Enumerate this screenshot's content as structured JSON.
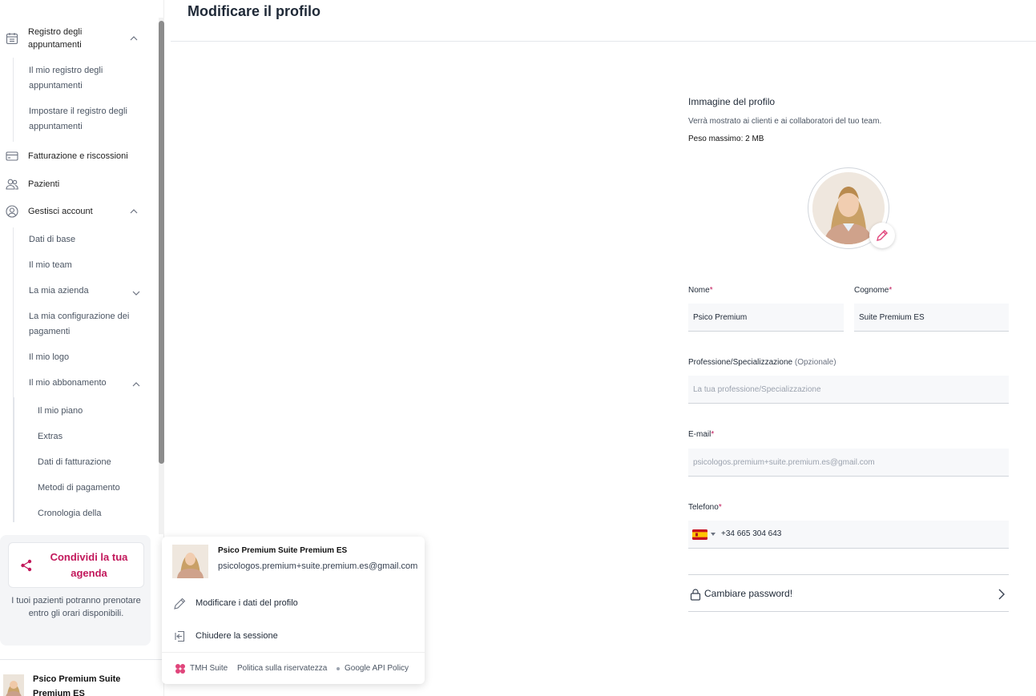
{
  "sidebar": {
    "registro": {
      "label": "Registro degli appuntamenti",
      "sub": [
        "Il mio registro degli appuntamenti",
        "Impostare il registro degli appuntamenti"
      ]
    },
    "fatturazione": "Fatturazione e riscossioni",
    "pazienti": "Pazienti",
    "account": {
      "label": "Gestisci account",
      "sub": [
        "Dati di base",
        "Il mio team",
        "La mia azienda",
        "La mia configurazione dei pagamenti",
        "Il mio logo",
        "Il mio abbonamento"
      ],
      "abbonamento": [
        "Il mio piano",
        "Extras",
        "Dati di fatturazione",
        "Metodi di pagamento",
        "Cronologia della"
      ]
    },
    "share": {
      "label": "Condividi la tua agenda",
      "desc": "I tuoi pazienti potranno prenotare entro gli orari disponibili."
    },
    "user_name": "Psico Premium Suite Premium ES"
  },
  "main": {
    "title": "Modificare il profilo",
    "profile_image": {
      "title": "Immagine del profilo",
      "desc": "Verrà mostrato ai clienti e ai collaboratori del tuo team.",
      "max_weight": "Peso massimo: 2 MB"
    },
    "form": {
      "nome_label": "Nome",
      "nome_value": "Psico Premium",
      "cognome_label": "Cognome",
      "cognome_value": "Suite Premium ES",
      "professione_label": "Professione/Specializzazione",
      "professione_optional": "(Opzionale)",
      "professione_placeholder": "La tua professione/Specializzazione",
      "email_label": "E-mail",
      "email_value": "psicologos.premium+suite.premium.es@gmail.com",
      "telefono_label": "Telefono",
      "telefono_value": "+34 665 304 643",
      "required_mark": "*"
    },
    "password": "Cambiare password!"
  },
  "menu": {
    "name": "Psico Premium Suite Premium ES",
    "email": "psicologos.premium+suite.premium.es@gmail.com",
    "edit": "Modificare i dati del profilo",
    "logout": "Chiudere la sessione",
    "brand": "TMH Suite",
    "privacy": "Politica sulla riservatezza",
    "google": "Google API Policy"
  },
  "colors": {
    "accent": "#c2185b",
    "scroll_thumb": "#8c8c8c"
  }
}
